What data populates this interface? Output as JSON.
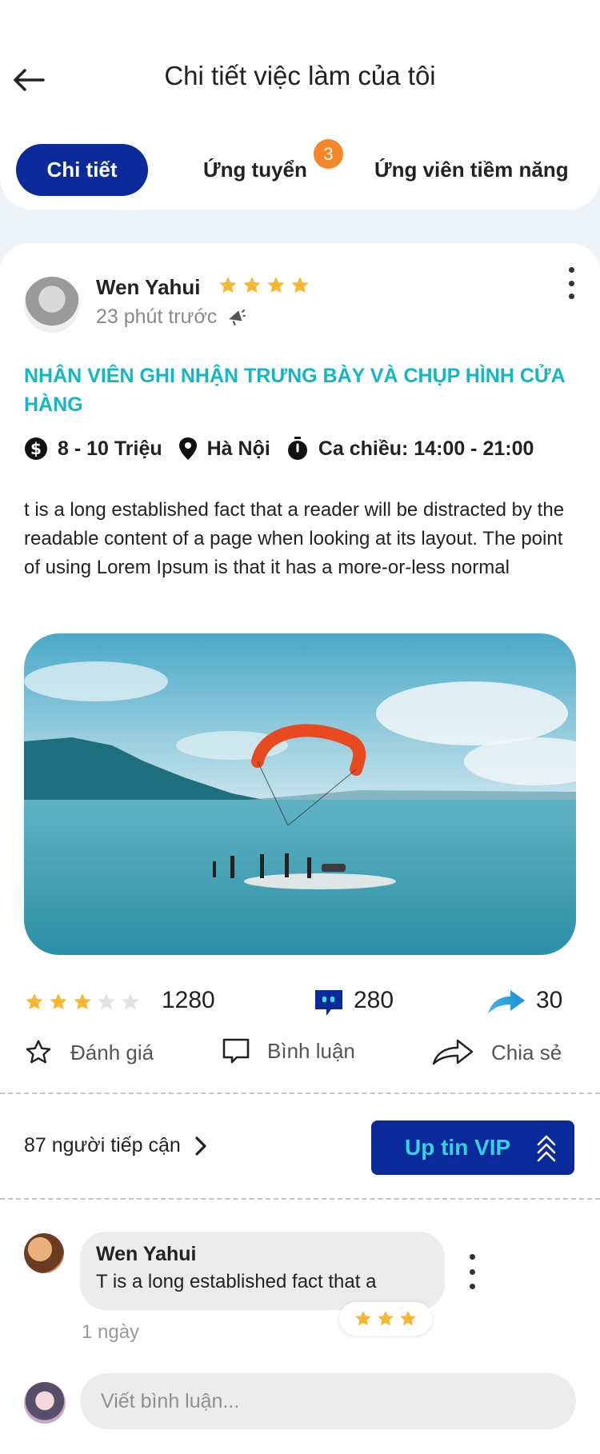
{
  "header": {
    "title": "Chi tiết việc làm của tôi",
    "tabs": [
      {
        "label": "Chi tiết",
        "active": true
      },
      {
        "label": "Ứng tuyển",
        "badge": "3"
      },
      {
        "label": "Ứng viên tiềm năng"
      }
    ]
  },
  "post": {
    "author": "Wen Yahui",
    "author_rating": 4,
    "time": "23 phút trước",
    "job_title": "NHÂN VIÊN GHI NHẬN TRƯNG BÀY VÀ CHỤP HÌNH CỬA HÀNG",
    "salary": "8 - 10 Triệu",
    "location": "Hà Nội",
    "shift": "Ca chiều: 14:00 - 21:00",
    "description": "t is a long established fact that a reader will be distracted by the readable content of a page when looking at its layout. The point of using Lorem Ipsum is that it has a more-or-less normal"
  },
  "stats": {
    "rating": 3,
    "rating_max": 5,
    "rating_count": "1280",
    "comments": "280",
    "shares": "30"
  },
  "actions": {
    "rate": "Đánh giá",
    "comment": "Bình luận",
    "share": "Chia sẻ"
  },
  "reach": {
    "text": "87 người tiếp cận",
    "vip_button": "Up tin VIP"
  },
  "comment": {
    "name": "Wen Yahui",
    "text": "T is a long established fact that a",
    "time": "1 ngày",
    "rating": 3
  },
  "composer": {
    "placeholder": "Viết bình luận..."
  },
  "colors": {
    "primary": "#0a2a9a",
    "accent": "#13b7c3",
    "star": "#f7b733",
    "badge": "#f6862a"
  }
}
